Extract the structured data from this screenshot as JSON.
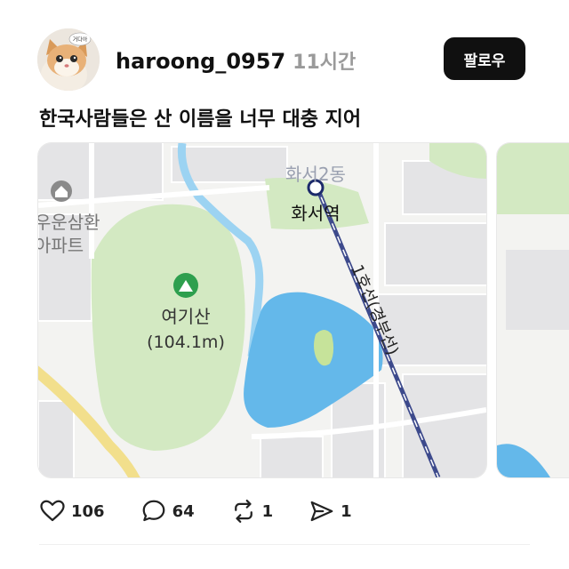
{
  "post": {
    "username": "haroong_0957",
    "time": "11시간",
    "follow_label": "팔로우",
    "avatar_bubble": "거다아",
    "caption": "한국사람들은 산 이름을 너무 대충 지어"
  },
  "map": {
    "district_label": "화서2동",
    "station_label": "화서역",
    "apartment_label_1": "우운삼환",
    "apartment_label_2": "아파트",
    "mountain_name": "여기산",
    "mountain_height": "(104.1m)",
    "rail_label": "1호선(경부선)",
    "colors": {
      "park": "#d3e9c2",
      "water": "#64b8ea",
      "rail": "#3d4a8c",
      "road_yellow": "#f2df8c",
      "land": "#f3f3f1",
      "building": "#e4e4e6"
    }
  },
  "actions": {
    "likes": "106",
    "comments": "64",
    "reposts": "1",
    "shares": "1"
  },
  "icons": [
    "heart-icon",
    "comment-icon",
    "repost-icon",
    "send-icon",
    "mountain-pin-icon",
    "home-pin-icon",
    "station-icon"
  ]
}
